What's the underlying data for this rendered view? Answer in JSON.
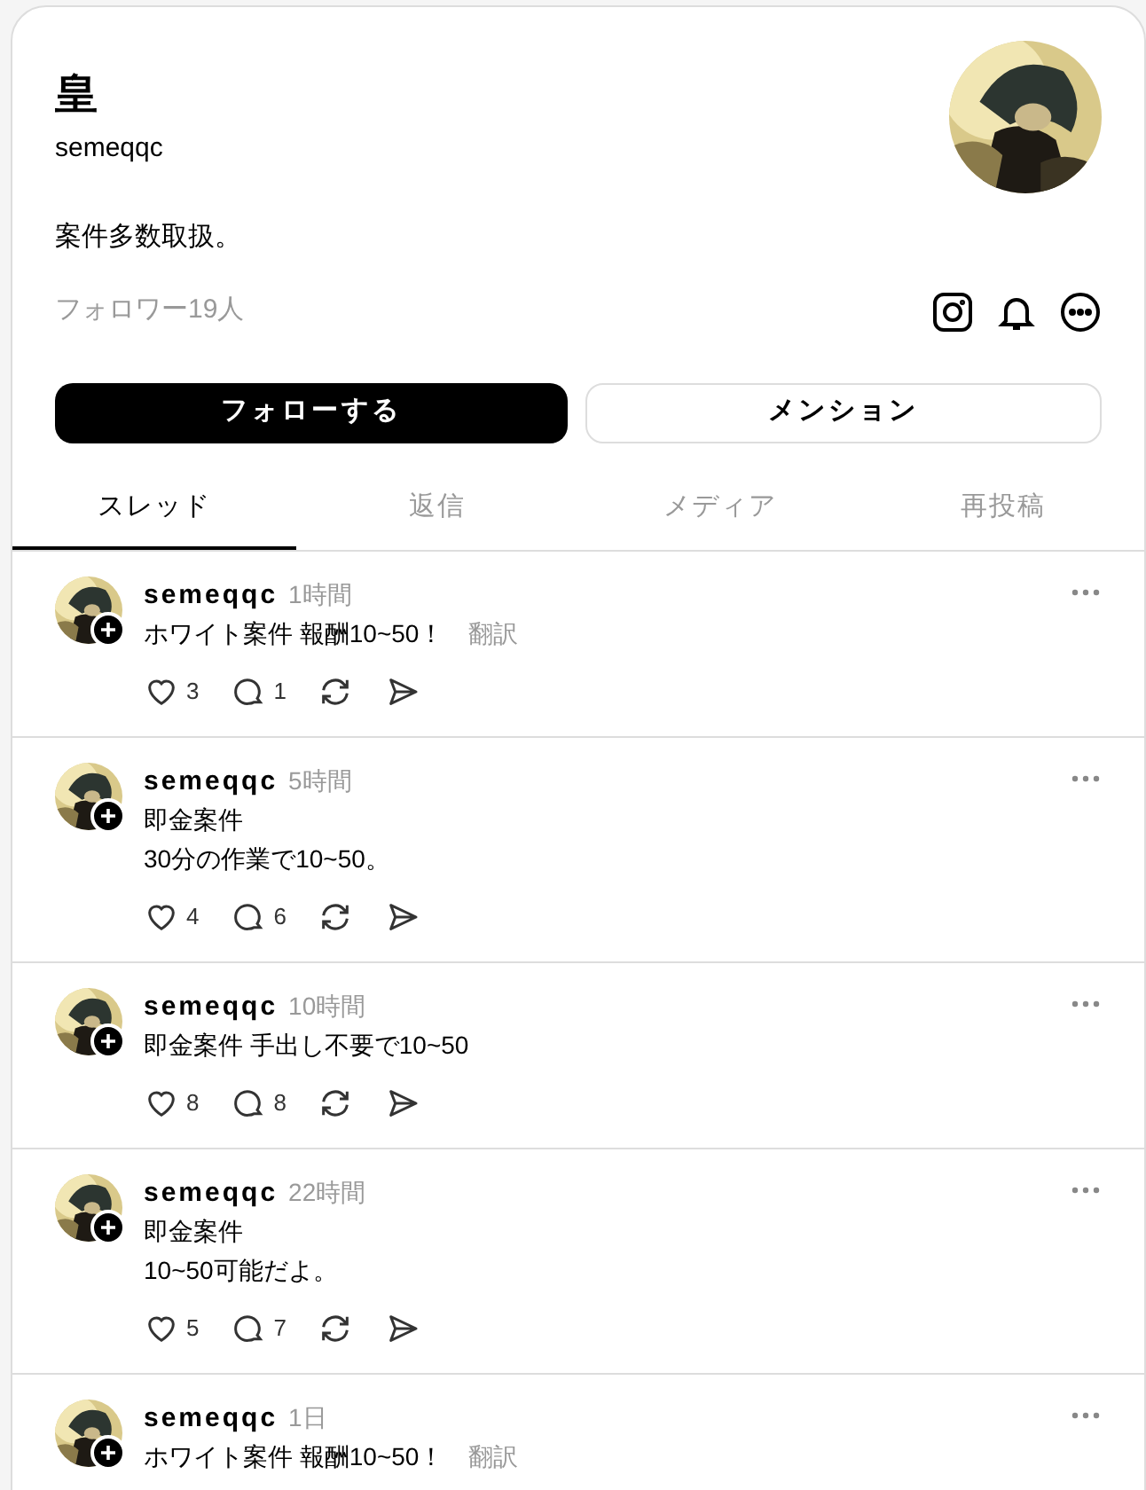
{
  "profile": {
    "name": "皇",
    "handle": "semeqqc",
    "bio": "案件多数取扱。",
    "followers": "フォロワー19人"
  },
  "buttons": {
    "follow": "フォローする",
    "mention": "メンション"
  },
  "tabs": [
    {
      "label": "スレッド",
      "selected": true
    },
    {
      "label": "返信",
      "selected": false
    },
    {
      "label": "メディア",
      "selected": false
    },
    {
      "label": "再投稿",
      "selected": false
    }
  ],
  "posts": [
    {
      "user": "semeqqc",
      "time": "1時間",
      "text": "ホワイト案件 報酬10~50！",
      "translate": "翻訳",
      "likes": "3",
      "replies": "1"
    },
    {
      "user": "semeqqc",
      "time": "5時間",
      "text": "即金案件\n30分の作業で10~50。",
      "likes": "4",
      "replies": "6"
    },
    {
      "user": "semeqqc",
      "time": "10時間",
      "text": "即金案件 手出し不要で10~50",
      "likes": "8",
      "replies": "8"
    },
    {
      "user": "semeqqc",
      "time": "22時間",
      "text": "即金案件\n10~50可能だよ。",
      "likes": "5",
      "replies": "7"
    },
    {
      "user": "semeqqc",
      "time": "1日",
      "text": "ホワイト案件 報酬10~50！",
      "translate": "翻訳"
    }
  ]
}
